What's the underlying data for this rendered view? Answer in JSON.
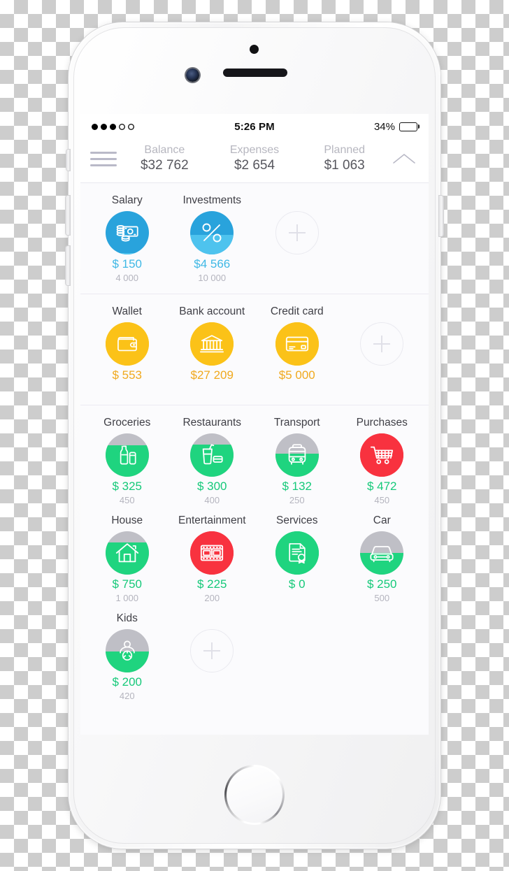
{
  "status_bar": {
    "signal_dots_filled": 3,
    "signal_dots_total": 5,
    "time": "5:26 PM",
    "battery_percent_label": "34%",
    "battery_level": 34
  },
  "summary": {
    "menu_icon": "hamburger-menu-icon",
    "collapse_icon": "chevron-up-icon",
    "items": [
      {
        "label": "Balance",
        "value": "$32 762"
      },
      {
        "label": "Expenses",
        "value": "$2 654"
      },
      {
        "label": "Planned",
        "value": "$1 063"
      }
    ]
  },
  "colors": {
    "income_dark": "#29A3DC",
    "income_light": "#4EC3EE",
    "account_yellow": "#FBC218",
    "expense_green": "#1FD47F",
    "expense_green_dark": "#23C97C",
    "expense_gray": "#BFBFC6",
    "expense_over_red": "#F8323F",
    "amount_blue": "#3FB8E5",
    "amount_yellow": "#F0A91E",
    "amount_green": "#16C97A",
    "budget_gray": "#B4B4BE"
  },
  "sections": {
    "income": {
      "name": "income",
      "add_button_label": "add-income-button",
      "tiles": [
        {
          "name": "Salary",
          "icon": "cash-money-icon",
          "amount": "$ 150",
          "budget": "4 000",
          "spent": 150,
          "goal": 4000
        },
        {
          "name": "Investments",
          "icon": "percent-icon",
          "amount": "$4 566",
          "budget": "10 000",
          "spent": 4566,
          "goal": 10000
        }
      ]
    },
    "accounts": {
      "name": "accounts",
      "add_button_label": "add-account-button",
      "tiles": [
        {
          "name": "Wallet",
          "icon": "wallet-icon",
          "amount": "$ 553",
          "budget": ""
        },
        {
          "name": "Bank account",
          "icon": "bank-icon",
          "amount": "$27 209",
          "budget": ""
        },
        {
          "name": "Credit card",
          "icon": "credit-card-icon",
          "amount": "$5 000",
          "budget": ""
        }
      ]
    },
    "expenses": {
      "name": "expenses",
      "add_button_label": "add-expense-button",
      "tiles": [
        {
          "name": "Groceries",
          "icon": "bottle-drink-icon",
          "amount": "$ 325",
          "budget": "450",
          "spent": 325,
          "goal": 450,
          "over": false
        },
        {
          "name": "Restaurants",
          "icon": "drink-cup-icon",
          "amount": "$ 300",
          "budget": "400",
          "spent": 300,
          "goal": 400,
          "over": false
        },
        {
          "name": "Transport",
          "icon": "bus-icon",
          "amount": "$ 132",
          "budget": "250",
          "spent": 132,
          "goal": 250,
          "over": false
        },
        {
          "name": "Purchases",
          "icon": "shopping-cart-icon",
          "amount": "$ 472",
          "budget": "450",
          "spent": 472,
          "goal": 450,
          "over": true
        },
        {
          "name": "House",
          "icon": "house-icon",
          "amount": "$ 750",
          "budget": "1 000",
          "spent": 750,
          "goal": 1000,
          "over": false
        },
        {
          "name": "Entertainment",
          "icon": "film-strip-icon",
          "amount": "$ 225",
          "budget": "200",
          "spent": 225,
          "goal": 200,
          "over": true
        },
        {
          "name": "Services",
          "icon": "certificate-icon",
          "amount": "$ 0",
          "budget": "",
          "spent": 0,
          "goal": 0,
          "over": false
        },
        {
          "name": "Car",
          "icon": "car-icon",
          "amount": "$ 250",
          "budget": "500",
          "spent": 250,
          "goal": 500,
          "over": false
        },
        {
          "name": "Kids",
          "icon": "baby-icon",
          "amount": "$ 200",
          "budget": "420",
          "spent": 200,
          "goal": 420,
          "over": false
        }
      ]
    }
  }
}
